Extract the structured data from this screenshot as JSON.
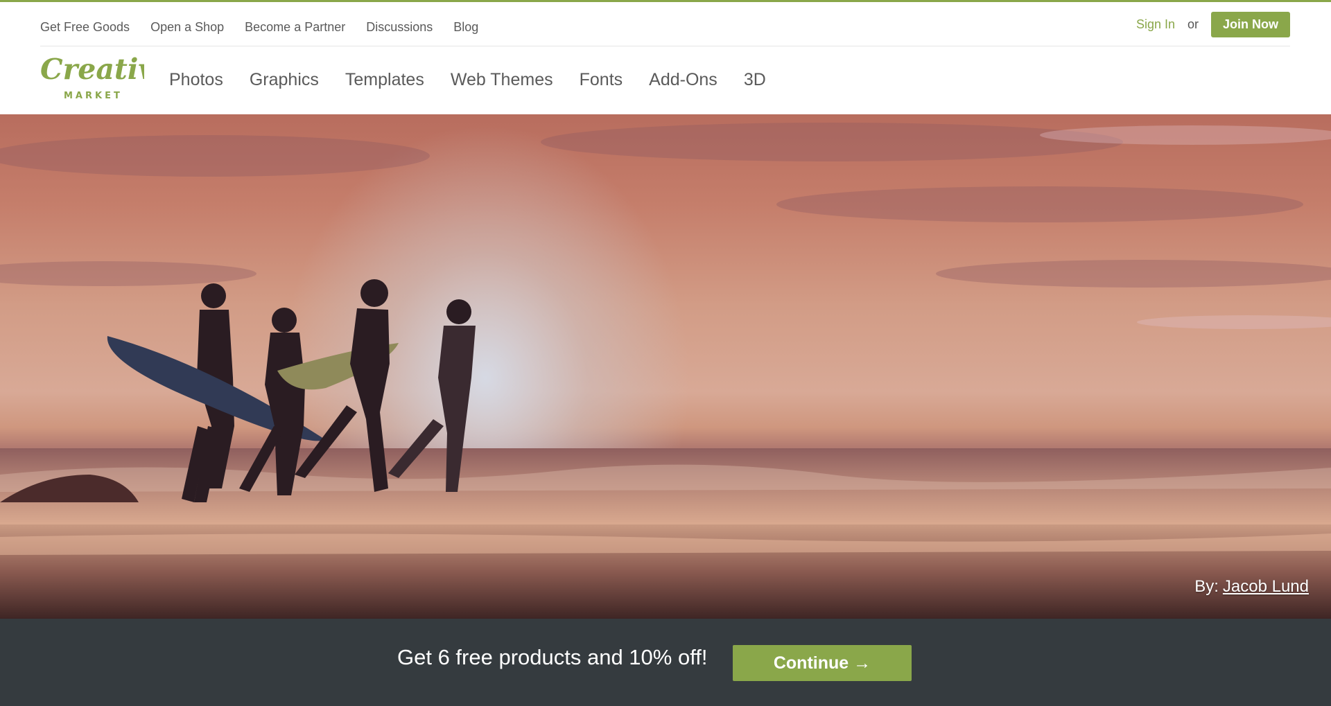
{
  "colors": {
    "brand_green": "#8aa74a",
    "dark_bar": "#353b3f",
    "nav_text": "#5a5a5a"
  },
  "utility_nav": {
    "links": [
      "Get Free Goods",
      "Open a Shop",
      "Become a Partner",
      "Discussions",
      "Blog"
    ],
    "sign_in": "Sign In",
    "or": "or",
    "join": "Join Now"
  },
  "brand": {
    "logo_word": "Creative",
    "logo_sub": "MARKET"
  },
  "main_nav": {
    "items": [
      "Photos",
      "Graphics",
      "Templates",
      "Web Themes",
      "Fonts",
      "Add-Ons",
      "3D"
    ]
  },
  "hero": {
    "credit_label": "By:",
    "credit_name": "Jacob Lund"
  },
  "cta": {
    "text": "Get 6 free products and 10% off!",
    "button": "Continue →"
  }
}
